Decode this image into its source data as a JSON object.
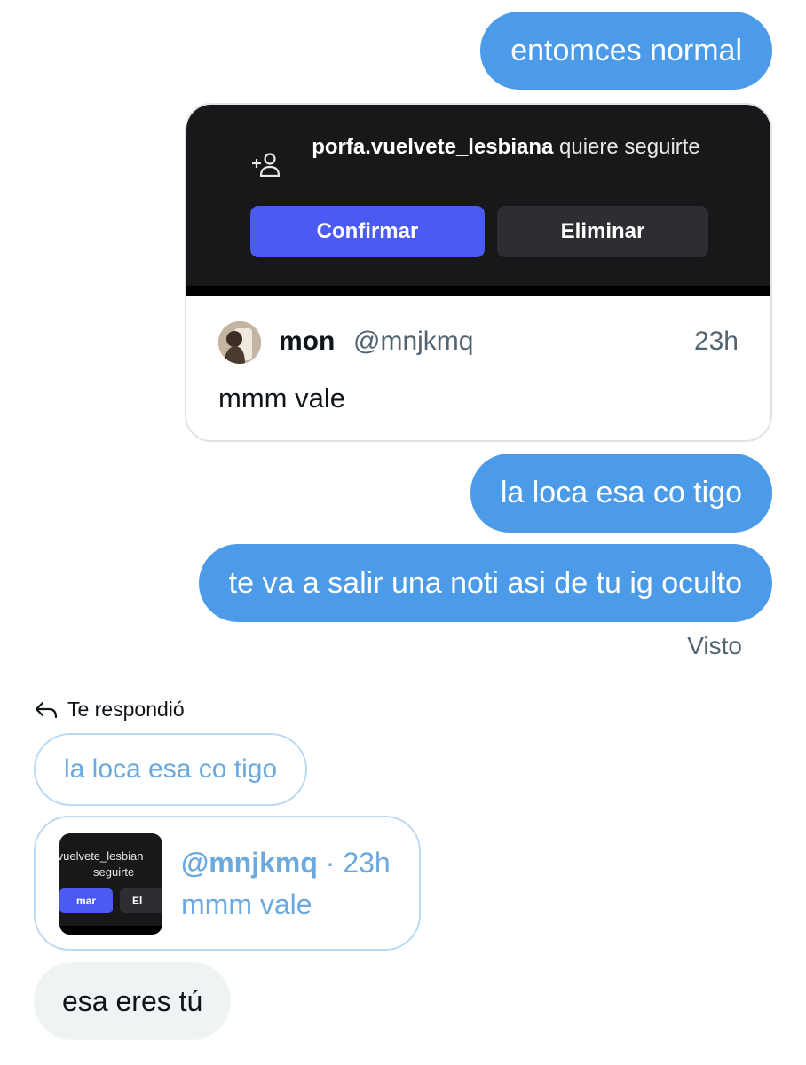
{
  "messages": {
    "sent_1": "entomces normal",
    "sent_2": "la loca esa co tigo",
    "sent_3": "te va a salir una noti asi de tu ig oculto",
    "seen_label": "Visto",
    "received_1": "esa eres tú"
  },
  "shared_card": {
    "follow_request": {
      "username": "porfa.vuelvete_lesbiana",
      "text": "quiere seguirte",
      "confirm_label": "Confirmar",
      "delete_label": "Eliminar",
      "icon": "add-user-icon"
    },
    "post": {
      "display_name": "mon",
      "handle": "@mnjkmq",
      "time": "23h",
      "text": "mmm vale"
    }
  },
  "reply": {
    "indicator_label": "Te respondió",
    "indicator_icon": "reply-arrow-icon",
    "quoted_message": "la loca esa co tigo",
    "quoted_post": {
      "thumb_username": ".vuelvete_lesbian",
      "thumb_follow": "seguirte",
      "thumb_confirm": "mar",
      "thumb_delete": "El",
      "handle": "@mnjkmq",
      "separator_time": " · 23h",
      "text": "mmm vale"
    }
  },
  "colors": {
    "sent_bubble": "#4c9be8",
    "received_bubble": "#eff3f4",
    "confirm_button": "#4b5bf1",
    "quote_text": "#6ba9de"
  }
}
